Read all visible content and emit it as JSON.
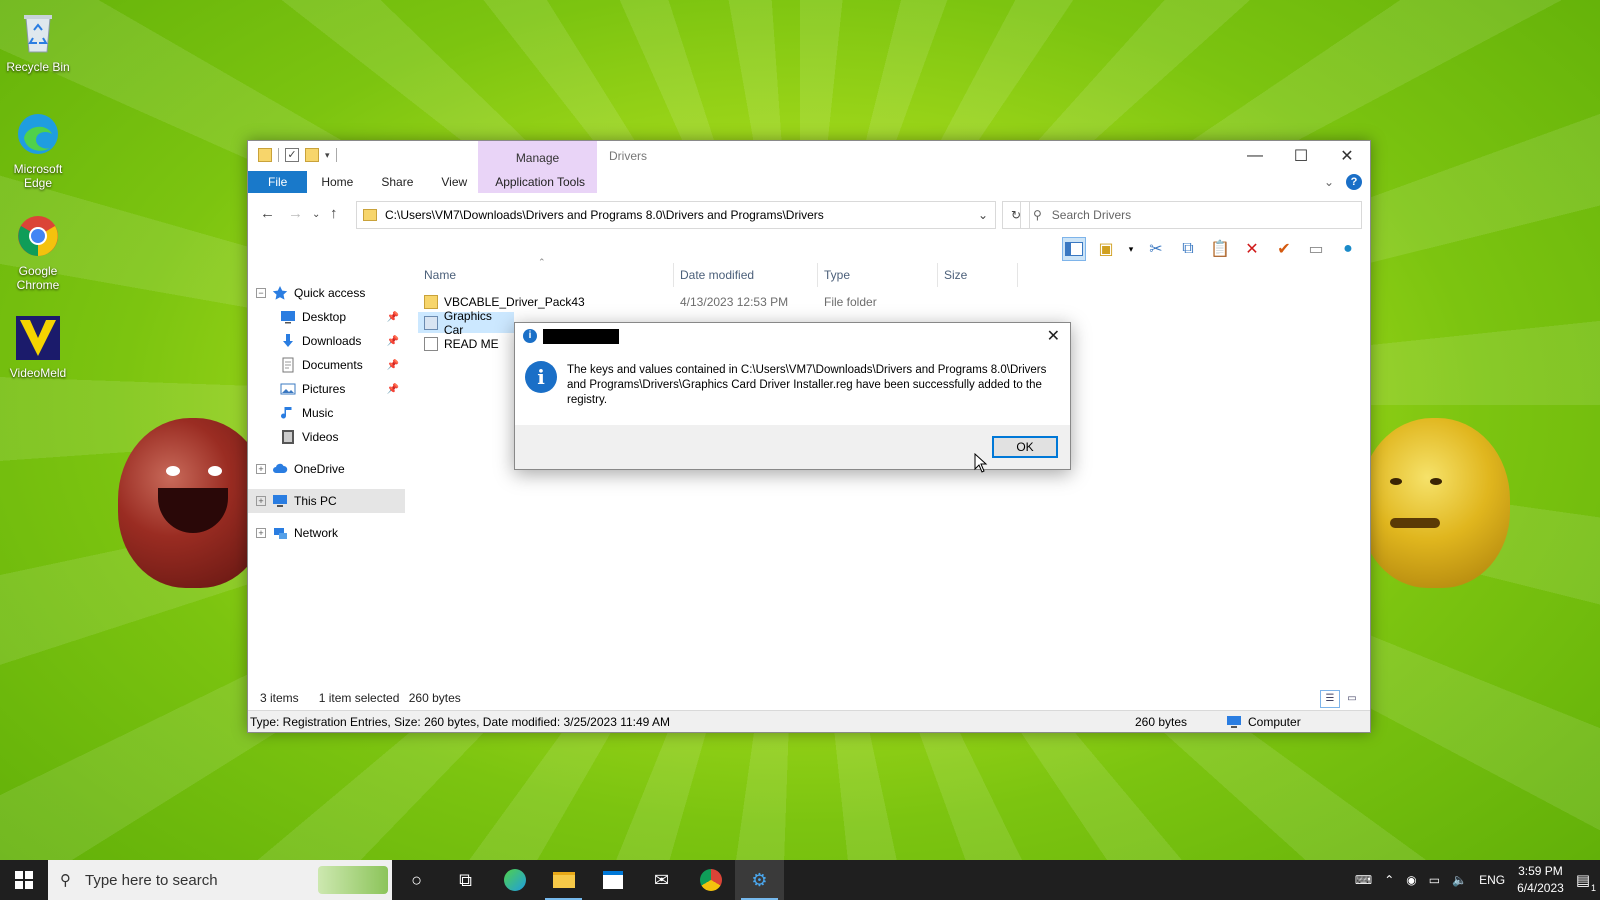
{
  "desktop": {
    "icons": [
      {
        "label": "Recycle Bin",
        "icon": "recycle-bin-icon"
      },
      {
        "label": "Microsoft Edge",
        "icon": "edge-icon"
      },
      {
        "label": "Google Chrome",
        "icon": "chrome-icon"
      },
      {
        "label": "VideoMeld",
        "icon": "videomeld-icon"
      }
    ]
  },
  "window": {
    "title": "Drivers",
    "manage_tab": "Manage",
    "ribbon_tabs": [
      "File",
      "Home",
      "Share",
      "View",
      "Application Tools"
    ],
    "address": "C:\\Users\\VM7\\Downloads\\Drivers and Programs 8.0\\Drivers and Programs\\Drivers",
    "search_placeholder": "Search Drivers",
    "nav": [
      {
        "label": "Quick access",
        "icon": "star-icon",
        "pinned": false
      },
      {
        "label": "Desktop",
        "icon": "desktop-icon",
        "pinned": true
      },
      {
        "label": "Downloads",
        "icon": "downloads-icon",
        "pinned": true
      },
      {
        "label": "Documents",
        "icon": "documents-icon",
        "pinned": true
      },
      {
        "label": "Pictures",
        "icon": "pictures-icon",
        "pinned": true
      },
      {
        "label": "Music",
        "icon": "music-icon",
        "pinned": false
      },
      {
        "label": "Videos",
        "icon": "videos-icon",
        "pinned": false
      },
      {
        "label": "OneDrive",
        "icon": "cloud-icon",
        "pinned": false
      },
      {
        "label": "This PC",
        "icon": "pc-icon",
        "pinned": false
      },
      {
        "label": "Network",
        "icon": "network-icon",
        "pinned": false
      }
    ],
    "columns": [
      "Name",
      "Date modified",
      "Type",
      "Size"
    ],
    "files": [
      {
        "name": "VBCABLE_Driver_Pack43",
        "date": "4/13/2023 12:53 PM",
        "type": "File folder",
        "size": ""
      },
      {
        "name": "Graphics Car",
        "date": "",
        "type": "",
        "size": ""
      },
      {
        "name": "READ ME",
        "date": "",
        "type": "",
        "size": ""
      }
    ],
    "status": {
      "items": "3 items",
      "selected": "1 item selected",
      "size": "260 bytes"
    },
    "details": {
      "text": "Type: Registration Entries, Size: 260 bytes, Date modified: 3/25/2023 11:49 AM",
      "size": "260 bytes",
      "location": "Computer"
    }
  },
  "dialog": {
    "message": "The keys and values contained in C:\\Users\\VM7\\Downloads\\Drivers and Programs 8.0\\Drivers and Programs\\Drivers\\Graphics Card Driver Installer.reg have been successfully added to the registry.",
    "ok_label": "OK"
  },
  "taskbar": {
    "search_placeholder": "Type here to search",
    "language": "ENG",
    "time": "3:59 PM",
    "date": "6/4/2023",
    "notification_count": "1"
  }
}
